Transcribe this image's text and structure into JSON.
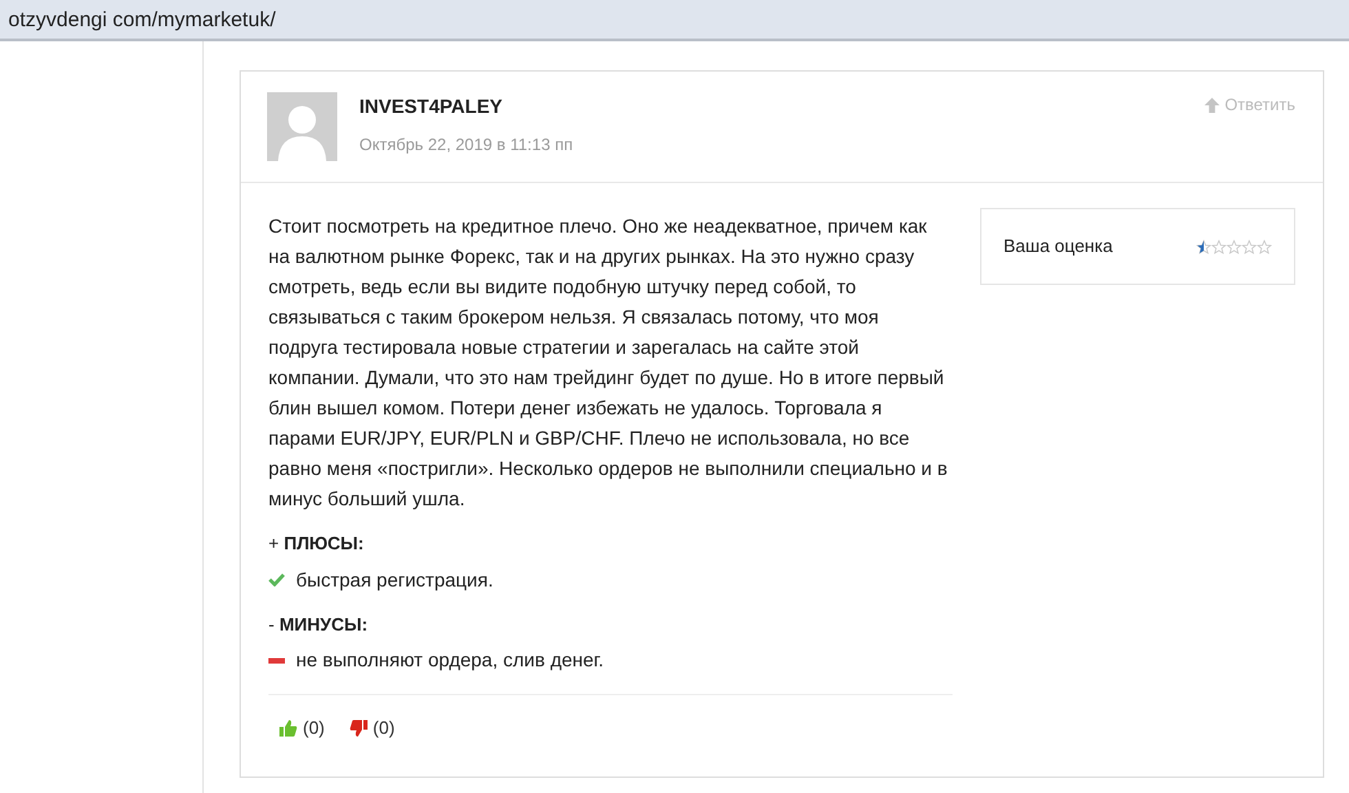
{
  "address_bar": {
    "url": "otzyvdengi com/mymarketuk/"
  },
  "comment": {
    "author": "INVEST4PALEY",
    "date": "Октябрь 22, 2019 в 11:13 пп",
    "reply": "Ответить",
    "text": "Стоит посмотреть на кредитное плечо. Оно же неадекватное, причем как на валютном рынке Форекс, так и на других рынках. На это нужно сразу смотреть, ведь если вы видите подобную штучку перед собой, то связываться с таким брокером нельзя. Я связалась потому, что моя подруга тестировала новые стратегии и зарегалась на сайте этой компании. Думали, что это нам трейдинг будет по душе. Но в итоге первый блин вышел комом. Потери денег избежать не удалось. Торговала я парами EUR/JPY, EUR/PLN и GBP/CHF. Плечо не использовала, но все равно меня «постригли». Несколько ордеров не выполнили специально и в минус больший ушла.",
    "sections": [
      {
        "kind": "pros",
        "heading": "+ **ПЛЮСЫ:**",
        "items": [
          "быстрая регистрация."
        ]
      },
      {
        "kind": "cons",
        "heading": "- **МИНУСЫ:**",
        "items": [
          "не выполняют ордера, слив денег."
        ]
      }
    ],
    "votes": [
      {
        "kind": "like",
        "count": "(0)"
      },
      {
        "kind": "dislike",
        "count": "(0)"
      }
    ],
    "rating": {
      "label": "Ваша оценка",
      "stars": 0.5
    }
  }
}
